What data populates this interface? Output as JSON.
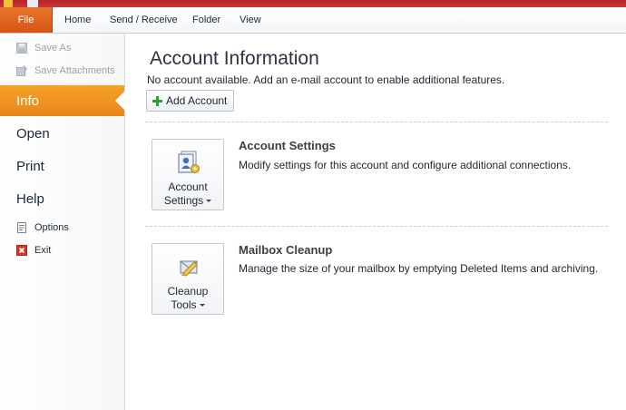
{
  "ribbon": {
    "tabs": [
      {
        "label": "File"
      },
      {
        "label": "Home"
      },
      {
        "label": "Send / Receive"
      },
      {
        "label": "Folder"
      },
      {
        "label": "View"
      }
    ]
  },
  "backstage_nav": {
    "small_items": [
      {
        "label": "Save As",
        "enabled": false,
        "icon": "save-as-icon"
      },
      {
        "label": "Save Attachments",
        "enabled": false,
        "icon": "save-attachments-icon"
      }
    ],
    "big_items": [
      {
        "label": "Info",
        "selected": true
      },
      {
        "label": "Open"
      },
      {
        "label": "Print"
      },
      {
        "label": "Help"
      }
    ],
    "bottom_items": [
      {
        "label": "Options",
        "icon": "options-icon"
      },
      {
        "label": "Exit",
        "icon": "exit-icon"
      }
    ]
  },
  "main": {
    "title": "Account Information",
    "subtitle": "No account available. Add an e-mail account to enable additional features.",
    "add_account_label": "Add Account",
    "sections": [
      {
        "button_line1": "Account",
        "button_line2": "Settings",
        "title": "Account Settings",
        "description": "Modify settings for this account and configure additional connections.",
        "icon": "account-settings-icon"
      },
      {
        "button_line1": "Cleanup",
        "button_line2": "Tools",
        "title": "Mailbox Cleanup",
        "description": "Manage the size of your mailbox by emptying Deleted Items and archiving.",
        "icon": "cleanup-tools-icon"
      }
    ]
  },
  "colors": {
    "file_tab": "#e06a22",
    "selected_nav": "#f19a24",
    "titlebar": "#c0302f"
  }
}
